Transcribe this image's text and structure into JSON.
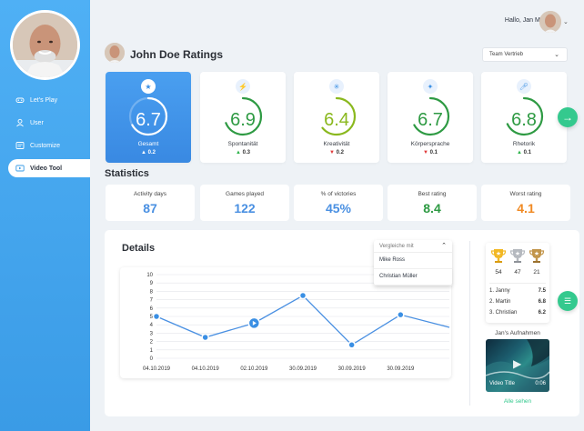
{
  "colors": {
    "accent": "#3a9be6",
    "green": "#34c98e",
    "up": "#2db34a",
    "down": "#e03a3a",
    "orange": "#f08a24",
    "blue_value": "#4a90e2",
    "green_value": "#2e9a43"
  },
  "sidebar": {
    "items": [
      {
        "label": "Let's Play",
        "icon": "gamepad-icon"
      },
      {
        "label": "User",
        "icon": "user-icon"
      },
      {
        "label": "Customize",
        "icon": "customize-icon"
      },
      {
        "label": "Video Tool",
        "icon": "video-icon",
        "active": true
      }
    ]
  },
  "header": {
    "greeting": "Hallo, Jan Müller!"
  },
  "page": {
    "title": "John Doe Ratings",
    "team_select": "Team Vertrieb"
  },
  "ratings": [
    {
      "label": "Gesamt",
      "score": "6.7",
      "trend": "0.2",
      "direction": "up",
      "icon": "star-icon",
      "color": "#ffffff",
      "fill": 0.67
    },
    {
      "label": "Spontanität",
      "score": "6.9",
      "trend": "0.3",
      "direction": "up",
      "icon": "lightning-icon",
      "color": "#2e9a43",
      "fill": 0.69
    },
    {
      "label": "Kreativität",
      "score": "6.4",
      "trend": "0.2",
      "direction": "down",
      "icon": "sparkle-icon",
      "color": "#8ab81e",
      "fill": 0.64
    },
    {
      "label": "Körpersprache",
      "score": "6.7",
      "trend": "0.1",
      "direction": "down",
      "icon": "figure-icon",
      "color": "#2e9a43",
      "fill": 0.67
    },
    {
      "label": "Rhetorik",
      "score": "6.8",
      "trend": "0.1",
      "direction": "up",
      "icon": "microphone-icon",
      "color": "#2e9a43",
      "fill": 0.68
    }
  ],
  "statistics": {
    "title": "Statistics",
    "cards": [
      {
        "label": "Activity days",
        "value": "87",
        "color": "#4a90e2"
      },
      {
        "label": "Games played",
        "value": "122",
        "color": "#4a90e2"
      },
      {
        "label": "% of victories",
        "value": "45%",
        "color": "#4a90e2"
      },
      {
        "label": "Best rating",
        "value": "8.4",
        "color": "#2e9a43"
      },
      {
        "label": "Worst rating",
        "value": "4.1",
        "color": "#f08a24"
      }
    ]
  },
  "details": {
    "title": "Details",
    "compare": {
      "placeholder": "Vergleiche mit",
      "options": [
        "Mike Ross",
        "Christian Müller"
      ]
    }
  },
  "chart_data": {
    "type": "line",
    "x": [
      "04.10.2019",
      "04.10.2019",
      "02.10.2019",
      "30.09.2019",
      "30.09.2019",
      "30.09.2019"
    ],
    "series": [
      {
        "values": [
          5,
          2.5,
          4.2,
          7.5,
          1.6,
          5.2,
          3.7
        ]
      }
    ],
    "ylim": [
      0,
      10
    ],
    "yticks": [
      0,
      1,
      2,
      3,
      4,
      5,
      6,
      7,
      8,
      9,
      10
    ],
    "grid": true
  },
  "trophies": [
    {
      "count": "54",
      "type": "gold",
      "color": "#f2b824"
    },
    {
      "count": "47",
      "type": "silver",
      "color": "#b5b9bf"
    },
    {
      "count": "21",
      "type": "bronze",
      "color": "#c2954a"
    }
  ],
  "ranking": [
    {
      "name": "1. Janny",
      "value": "7.5"
    },
    {
      "name": "2. Martin",
      "value": "6.8"
    },
    {
      "name": "3. Christian",
      "value": "6.2"
    }
  ],
  "recordings": {
    "title": "Jan's Aufnahmen",
    "video_title": "Video Title",
    "duration": "0:06",
    "see_all": "Alle sehen"
  }
}
